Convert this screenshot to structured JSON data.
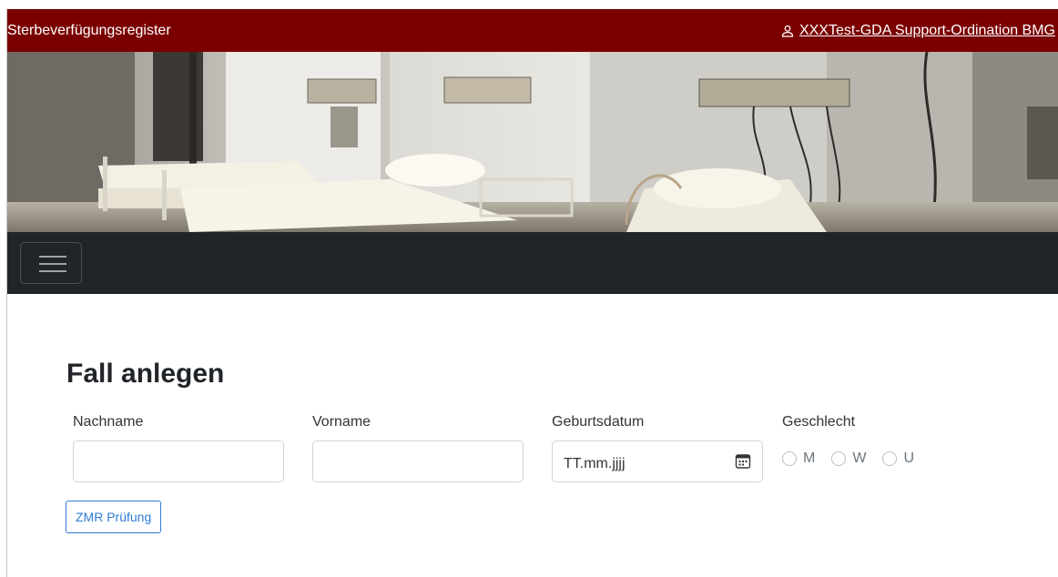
{
  "header": {
    "app_title": "Sterbeverfügungsregister",
    "user_link": "XXXTest-GDA Support-Ordination BMG",
    "user_icon": "person-icon",
    "background_color": "#7a0000"
  },
  "hero": {
    "image_description": "hospital-room-beds-photo"
  },
  "navbar": {
    "toggle_icon": "hamburger-menu-icon",
    "background_color": "#212529"
  },
  "form": {
    "title": "Fall anlegen",
    "fields": {
      "nachname": {
        "label": "Nachname",
        "value": ""
      },
      "vorname": {
        "label": "Vorname",
        "value": ""
      },
      "geburtsdatum": {
        "label": "Geburtsdatum",
        "placeholder": "TT.mm.jjjj",
        "icon": "calendar-icon"
      },
      "geschlecht": {
        "label": "Geschlecht",
        "options": [
          "M",
          "W",
          "U"
        ],
        "selected": null
      }
    },
    "zmr_button": "ZMR Prüfung",
    "accent_color": "#2f7bd6"
  }
}
